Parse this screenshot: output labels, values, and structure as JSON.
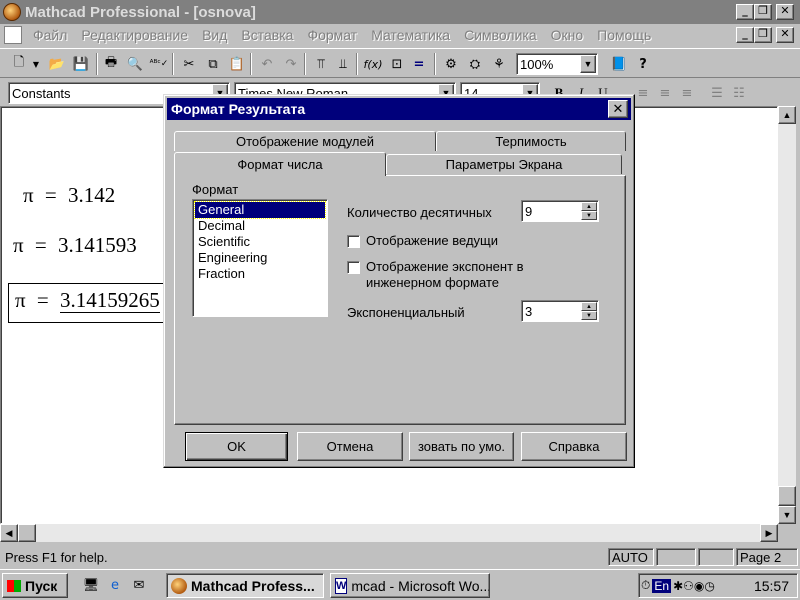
{
  "window": {
    "title": "Mathcad Professional - [osnova]"
  },
  "menu": [
    "Файл",
    "Редактирование",
    "Вид",
    "Вставка",
    "Формат",
    "Математика",
    "Символика",
    "Окно",
    "Помощь"
  ],
  "toolbar": {
    "zoom": "100%"
  },
  "formatbar": {
    "style": "Constants",
    "font": "Times New Roman",
    "size": "14",
    "bold": "B",
    "italic": "I",
    "underline": "U"
  },
  "document": {
    "lines": [
      {
        "symbol": "π",
        "eq": "=",
        "value": "3.142"
      },
      {
        "symbol": "π",
        "eq": "=",
        "value": "3.141593"
      },
      {
        "symbol": "π",
        "eq": "=",
        "value": "3.14159265"
      }
    ]
  },
  "status": {
    "help": "Press F1 for help.",
    "mode": "AUTO",
    "page": "Page 2"
  },
  "taskbar": {
    "start": "Пуск",
    "tasks": [
      "Mathcad Profess...",
      "mcad - Microsoft Wo..."
    ],
    "lang": "En",
    "clock": "15:57"
  },
  "dialog": {
    "title": "Формат Результата",
    "tabs_back": [
      "Отображение модулей",
      "Терпимость"
    ],
    "tabs_front": [
      "Формат числа",
      "Параметры Экрана"
    ],
    "format_label": "Формат",
    "formats": [
      "General",
      "Decimal",
      "Scientific",
      "Engineering",
      "Fraction"
    ],
    "selected_format": "General",
    "decimals_label": "Количество десятичных",
    "decimals_value": "9",
    "leading_label": "Отображение ведущи",
    "eng_label_1": "Отображение экспонент в",
    "eng_label_2": "инженерном формате",
    "exp_label": "Экспоненциальный",
    "exp_value": "3",
    "buttons": {
      "ok": "OK",
      "cancel": "Отмена",
      "default": "зовать по умо.",
      "help": "Справка"
    }
  },
  "colors": {
    "titlebar_inactive": "#808080",
    "dialog_title": "#00007b",
    "selection": "#00007b"
  }
}
